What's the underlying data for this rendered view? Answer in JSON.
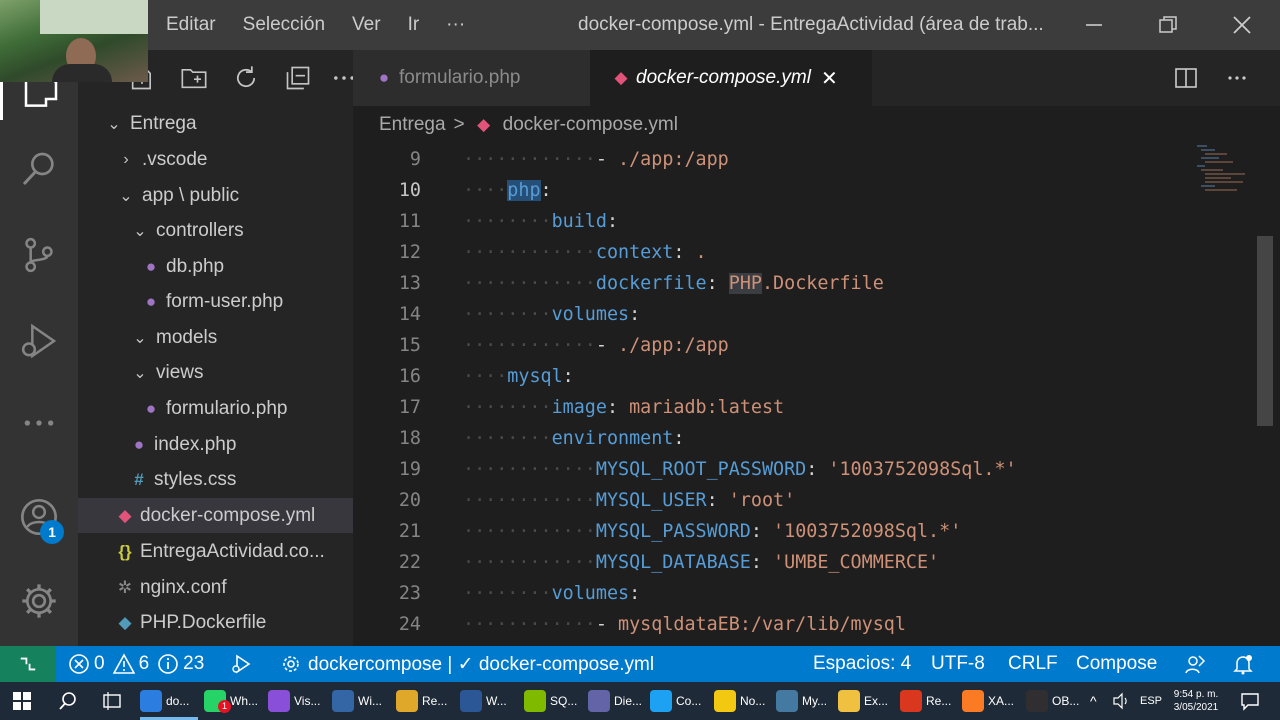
{
  "titlebar": {
    "menu": [
      "Editar",
      "Selección",
      "Ver",
      "Ir",
      "···"
    ],
    "window_title": "docker-compose.yml - EntregaActividad (área de trab..."
  },
  "activity_bar": {
    "accounts_badge": "1"
  },
  "explorer": {
    "root": "Entrega",
    "items": [
      {
        "label": ".vscode",
        "kind": "folder-collapsed"
      },
      {
        "label": "app \\ public",
        "kind": "folder-open"
      },
      {
        "label": "controllers",
        "kind": "folder-open"
      },
      {
        "label": "db.php",
        "kind": "php-file"
      },
      {
        "label": "form-user.php",
        "kind": "php-file"
      },
      {
        "label": "models",
        "kind": "folder-open"
      },
      {
        "label": "views",
        "kind": "folder-open"
      },
      {
        "label": "formulario.php",
        "kind": "php-file"
      },
      {
        "label": "index.php",
        "kind": "php-file"
      },
      {
        "label": "styles.css",
        "kind": "css-file"
      },
      {
        "label": "docker-compose.yml",
        "kind": "docker-file",
        "selected": true
      },
      {
        "label": "EntregaActividad.co...",
        "kind": "json-file"
      },
      {
        "label": "nginx.conf",
        "kind": "config-file"
      },
      {
        "label": "PHP.Dockerfile",
        "kind": "docker-file"
      }
    ]
  },
  "tabs": [
    {
      "label": "formulario.php",
      "active": false
    },
    {
      "label": "docker-compose.yml",
      "active": true,
      "close": "✕"
    }
  ],
  "breadcrumb": {
    "folder": "Entrega",
    "separator": ">",
    "file": "docker-compose.yml"
  },
  "editor": {
    "current_line": "10",
    "lines": [
      {
        "n": "9",
        "indent": 3,
        "parts": [
          [
            "p",
            "- "
          ],
          [
            "s",
            "./app:/app"
          ]
        ]
      },
      {
        "n": "10",
        "indent": 1,
        "parts": [
          [
            "k",
            "php",
            "hl"
          ],
          [
            "p",
            ":"
          ]
        ]
      },
      {
        "n": "11",
        "indent": 2,
        "parts": [
          [
            "k",
            "build"
          ],
          [
            "p",
            ":"
          ]
        ]
      },
      {
        "n": "12",
        "indent": 3,
        "parts": [
          [
            "k",
            "context"
          ],
          [
            "p",
            ": "
          ],
          [
            "s",
            "."
          ]
        ]
      },
      {
        "n": "13",
        "indent": 3,
        "parts": [
          [
            "k",
            "dockerfile"
          ],
          [
            "p",
            ": "
          ],
          [
            "s",
            "PHP",
            "hl2"
          ],
          [
            "s",
            ".Dockerfile"
          ]
        ]
      },
      {
        "n": "14",
        "indent": 2,
        "parts": [
          [
            "k",
            "volumes"
          ],
          [
            "p",
            ":"
          ]
        ]
      },
      {
        "n": "15",
        "indent": 3,
        "parts": [
          [
            "p",
            "- "
          ],
          [
            "s",
            "./app:/app"
          ]
        ]
      },
      {
        "n": "16",
        "indent": 1,
        "parts": [
          [
            "k",
            "mysql"
          ],
          [
            "p",
            ":"
          ]
        ]
      },
      {
        "n": "17",
        "indent": 2,
        "parts": [
          [
            "k",
            "image"
          ],
          [
            "p",
            ": "
          ],
          [
            "s",
            "mariadb:latest"
          ]
        ]
      },
      {
        "n": "18",
        "indent": 2,
        "parts": [
          [
            "k",
            "environment"
          ],
          [
            "p",
            ":"
          ]
        ]
      },
      {
        "n": "19",
        "indent": 3,
        "parts": [
          [
            "k",
            "MYSQL_ROOT_PASSWORD"
          ],
          [
            "p",
            ": "
          ],
          [
            "s",
            "'1003752098Sql.*'"
          ]
        ]
      },
      {
        "n": "20",
        "indent": 3,
        "parts": [
          [
            "k",
            "MYSQL_USER"
          ],
          [
            "p",
            ": "
          ],
          [
            "s",
            "'root'"
          ]
        ]
      },
      {
        "n": "21",
        "indent": 3,
        "parts": [
          [
            "k",
            "MYSQL_PASSWORD"
          ],
          [
            "p",
            ": "
          ],
          [
            "s",
            "'1003752098Sql.*'"
          ]
        ]
      },
      {
        "n": "22",
        "indent": 3,
        "parts": [
          [
            "k",
            "MYSQL_DATABASE"
          ],
          [
            "p",
            ": "
          ],
          [
            "s",
            "'UMBE_COMMERCE'"
          ]
        ]
      },
      {
        "n": "23",
        "indent": 2,
        "parts": [
          [
            "k",
            "volumes"
          ],
          [
            "p",
            ":"
          ]
        ]
      },
      {
        "n": "24",
        "indent": 3,
        "parts": [
          [
            "p",
            "- "
          ],
          [
            "s",
            "mysqldataEB:/var/lib/mysql"
          ]
        ]
      }
    ]
  },
  "statusbar": {
    "errors": "0",
    "warnings": "6",
    "info": "23",
    "task": "dockercompose | ✓ docker-compose.yml",
    "spaces": "Espacios: 4",
    "encoding": "UTF-8",
    "eol": "CRLF",
    "language": "Compose"
  },
  "taskbar": {
    "apps": [
      {
        "label": "do...",
        "color": "#2b7de0"
      },
      {
        "label": "Wh...",
        "color": "#25d366"
      },
      {
        "label": "Vis...",
        "color": "#8a4fd8"
      },
      {
        "label": "Wi...",
        "color": "#3465a4"
      },
      {
        "label": "Re...",
        "color": "#e0a82b"
      },
      {
        "label": "W...",
        "color": "#2b5797"
      },
      {
        "label": "SQ...",
        "color": "#7fba00"
      },
      {
        "label": "Die...",
        "color": "#6264a7"
      },
      {
        "label": "Co...",
        "color": "#1da1f2"
      },
      {
        "label": "No...",
        "color": "#f2c811"
      },
      {
        "label": "My...",
        "color": "#4479a1"
      },
      {
        "label": "Ex...",
        "color": "#f0c040"
      },
      {
        "label": "Re...",
        "color": "#d9381e"
      },
      {
        "label": "XA...",
        "color": "#fb7a24"
      },
      {
        "label": "OB...",
        "color": "#302e31"
      }
    ],
    "language": "ESP",
    "time": "9:54 p. m.",
    "date": "3/05/2021",
    "whatsapp_badge": "1"
  }
}
